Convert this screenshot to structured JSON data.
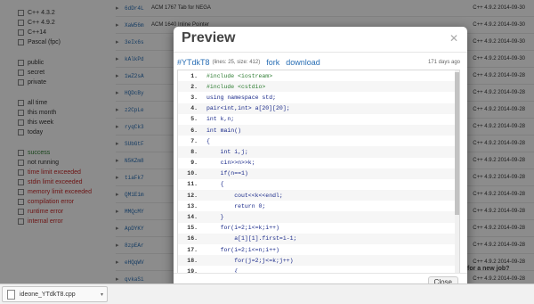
{
  "filters": {
    "languages": [
      "C++ 4.3.2",
      "C++ 4.9.2",
      "C++14",
      "Pascal (fpc)"
    ],
    "visibility": [
      "public",
      "secret",
      "private"
    ],
    "time": [
      "all time",
      "this month",
      "this week",
      "today"
    ],
    "status": [
      {
        "label": "success",
        "color": "#2e7d32"
      },
      {
        "label": "not running",
        "color": "#333333"
      },
      {
        "label": "time limit exceeded",
        "color": "#c62828"
      },
      {
        "label": "stdin limit exceeded",
        "color": "#c62828"
      },
      {
        "label": "memory limit exceeded",
        "color": "#c62828"
      },
      {
        "label": "compilation error",
        "color": "#c62828"
      },
      {
        "label": "runtime error",
        "color": "#c62828"
      },
      {
        "label": "internal error",
        "color": "#c62828"
      }
    ]
  },
  "runs": [
    {
      "id": "6dDr4L",
      "title": "ACM 1767 Tab for NEGA",
      "lang": "C++ 4.9.2 2014-09-30"
    },
    {
      "id": "XaW56m",
      "title": "ACM 1640 Inline Pointer",
      "lang": "C++ 4.9.2 2014-09-30"
    },
    {
      "id": "3eIx6s",
      "title": "",
      "lang": "C++ 4.9.2 2014-09-30"
    },
    {
      "id": "kAlkPd",
      "title": "",
      "lang": "C++ 4.9.2 2014-09-30"
    },
    {
      "id": "1wZ2sA",
      "title": "",
      "lang": "C++ 4.9.2 2014-09-28"
    },
    {
      "id": "HQDcBy",
      "title": "",
      "lang": "C++ 4.9.2 2014-09-28"
    },
    {
      "id": "z2CpLe",
      "title": "",
      "lang": "C++ 4.9.2 2014-09-28"
    },
    {
      "id": "ryqCk3",
      "title": "",
      "lang": "C++ 4.9.2 2014-09-28"
    },
    {
      "id": "SUbGtF",
      "title": "",
      "lang": "C++ 4.9.2 2014-09-28"
    },
    {
      "id": "N5KZm8",
      "title": "",
      "lang": "C++ 4.9.2 2014-09-28"
    },
    {
      "id": "tiaFk7",
      "title": "",
      "lang": "C++ 4.9.2 2014-09-28"
    },
    {
      "id": "QM1E1m",
      "title": "",
      "lang": "C++ 4.9.2 2014-09-28"
    },
    {
      "id": "MMQcMY",
      "title": "",
      "lang": "C++ 4.9.2 2014-09-28"
    },
    {
      "id": "ApDYKY",
      "title": "",
      "lang": "C++ 4.9.2 2014-09-28"
    },
    {
      "id": "8zpEAr",
      "title": "",
      "lang": "C++ 4.9.2 2014-09-28"
    },
    {
      "id": "eHQqWV",
      "title": "",
      "lang": "C++ 4.9.2 2014-09-28"
    },
    {
      "id": "qvkaSi",
      "title": "",
      "lang": "C++ 4.9.2 2014-09-28"
    },
    {
      "id": "dGTRhn",
      "title": "",
      "lang": ""
    }
  ],
  "background_tail": "for a new job?",
  "modal": {
    "title": "Preview",
    "paste_id": "#YTdkT8",
    "meta": "(lines: 25, size: 412)",
    "fork": "fork",
    "download": "download",
    "ago": "171 days ago",
    "close": "Close",
    "code": [
      {
        "n": "1.",
        "t": "#include <iostream>",
        "pp": true
      },
      {
        "n": "2.",
        "t": "#include <cstdio>",
        "pp": true
      },
      {
        "n": "3.",
        "t": "using namespace std;",
        "pp": false
      },
      {
        "n": "4.",
        "t": "pair<int,int> a[20][20];",
        "pp": false
      },
      {
        "n": "5.",
        "t": "int k,n;",
        "pp": false
      },
      {
        "n": "6.",
        "t": "int main()",
        "pp": false
      },
      {
        "n": "7.",
        "t": "{",
        "pp": false
      },
      {
        "n": "8.",
        "t": "    int i,j;",
        "pp": false
      },
      {
        "n": "9.",
        "t": "    cin>>n>>k;",
        "pp": false
      },
      {
        "n": "10.",
        "t": "    if(n==1)",
        "pp": false
      },
      {
        "n": "11.",
        "t": "    {",
        "pp": false
      },
      {
        "n": "12.",
        "t": "        cout<<k<<endl;",
        "pp": false
      },
      {
        "n": "13.",
        "t": "        return 0;",
        "pp": false
      },
      {
        "n": "14.",
        "t": "    }",
        "pp": false
      },
      {
        "n": "15.",
        "t": "    for(i=2;i<=k;i++)",
        "pp": false
      },
      {
        "n": "16.",
        "t": "        a[1][1].first=i-1;",
        "pp": false
      },
      {
        "n": "17.",
        "t": "    for(i=2;i<=n;i++)",
        "pp": false
      },
      {
        "n": "18.",
        "t": "        for(j=2;j<=k;j++)",
        "pp": false
      },
      {
        "n": "19.",
        "t": "        {",
        "pp": false
      },
      {
        "n": "20.",
        "t": "",
        "pp": false
      }
    ]
  },
  "download_bar": {
    "file": "ideone_YTdkT8.cpp",
    "arrow": "▾"
  }
}
